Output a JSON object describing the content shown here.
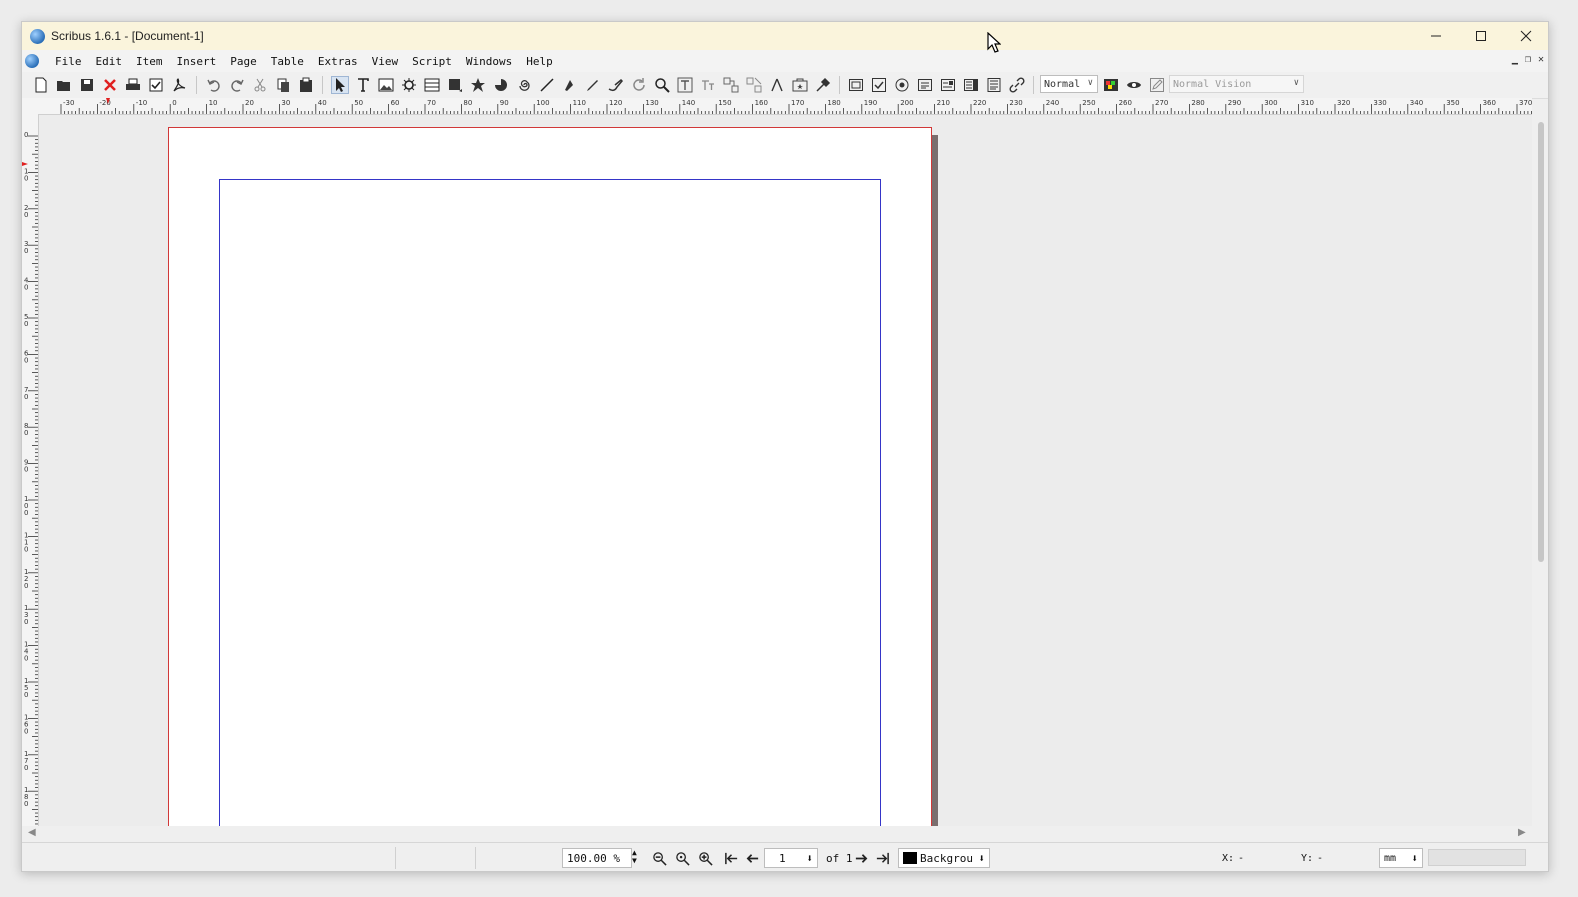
{
  "window": {
    "title": "Scribus 1.6.1 - [Document-1]"
  },
  "menubar": {
    "items": [
      "File",
      "Edit",
      "Item",
      "Insert",
      "Page",
      "Table",
      "Extras",
      "View",
      "Script",
      "Windows",
      "Help"
    ]
  },
  "toolbar": {
    "icons": [
      "new-document",
      "open",
      "save",
      "close-document",
      "print",
      "preflight-check",
      "export-pdf",
      "undo",
      "redo",
      "cut",
      "copy",
      "paste",
      "select",
      "text-frame",
      "image-frame",
      "render-frame",
      "table",
      "shape",
      "polygon",
      "arc",
      "spiral",
      "line",
      "bezier",
      "freehand",
      "calligraphic",
      "rotate",
      "zoom",
      "edit-contents",
      "edit-text",
      "link-frames",
      "unlink-frames",
      "measure",
      "copy-properties",
      "eyedropper",
      "pdf-push-button",
      "pdf-checkbox",
      "pdf-radio",
      "pdf-text-field",
      "pdf-combo-box",
      "pdf-list-box",
      "pdf-text-annotation",
      "pdf-link-annotation"
    ],
    "image_preview_mode": "Normal",
    "vision_mode": "Normal Vision"
  },
  "rulers": {
    "horizontal_labels": [
      "-30",
      "-20",
      "-10",
      "0",
      "10",
      "20",
      "30",
      "40",
      "50",
      "60",
      "70",
      "80",
      "90",
      "100",
      "110",
      "120",
      "130",
      "140",
      "150",
      "160",
      "170",
      "180",
      "190",
      "200",
      "210",
      "220",
      "230",
      "240",
      "250",
      "260",
      "270",
      "280",
      "290",
      "300",
      "310",
      "320",
      "330",
      "340",
      "350",
      "360",
      "370"
    ],
    "vertical_labels": [
      "0",
      "10",
      "20",
      "30",
      "40",
      "50",
      "60",
      "70",
      "80",
      "90",
      "100",
      "110",
      "120",
      "130",
      "140",
      "150",
      "160",
      "170",
      "180"
    ]
  },
  "statusbar": {
    "zoom": "100.00 %",
    "page_current": "1",
    "page_of": "of 1",
    "layer": "Backgrou",
    "x_label": "X:",
    "x_value": "-",
    "y_label": "Y:",
    "y_value": "-",
    "unit": "mm"
  },
  "colors": {
    "page_border": "#d13838",
    "margin_guides": "#3535c8",
    "titlebar": "#faf4dc"
  }
}
